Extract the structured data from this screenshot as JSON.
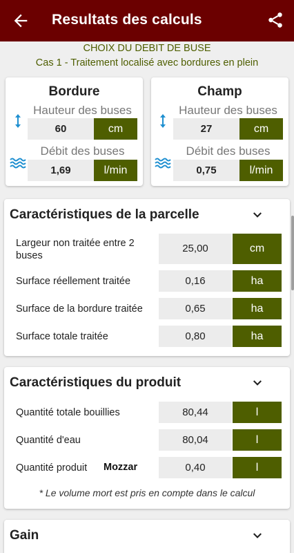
{
  "app": {
    "title": "Resultats des calculs"
  },
  "header": {
    "line1": "CHOIX DU DEBIT DE BUSE",
    "line2": "Cas 1 - Traitement localisé avec bordures en plein"
  },
  "bordure": {
    "title": "Bordure",
    "height_label": "Hauteur des buses",
    "height_value": "60",
    "height_unit": "cm",
    "flow_label": "Débit des buses",
    "flow_value": "1,69",
    "flow_unit": "l/min"
  },
  "champ": {
    "title": "Champ",
    "height_label": "Hauteur des buses",
    "height_value": "27",
    "height_unit": "cm",
    "flow_label": "Débit des buses",
    "flow_value": "0,75",
    "flow_unit": "l/min"
  },
  "parcelle": {
    "title": "Caractéristiques de la parcelle",
    "rows": [
      {
        "label": "Largeur non traitée entre 2 buses",
        "value": "25,00",
        "unit": "cm"
      },
      {
        "label": "Surface réellement traitée",
        "value": "0,16",
        "unit": "ha"
      },
      {
        "label": "Surface de la bordure traitée",
        "value": "0,65",
        "unit": "ha"
      },
      {
        "label": "Surface totale traitée",
        "value": "0,80",
        "unit": "ha"
      }
    ]
  },
  "produit": {
    "title": "Caractéristiques du produit",
    "rows": [
      {
        "label": "Quantité totale bouillies",
        "value": "80,44",
        "unit": "l"
      },
      {
        "label": "Quantité d'eau",
        "value": "80,04",
        "unit": "l"
      },
      {
        "label": "Quantité produit",
        "product": "Mozzar",
        "value": "0,40",
        "unit": "l"
      }
    ],
    "note": "* Le volume mort est pris en compte dans le calcul"
  },
  "gain": {
    "title": "Gain"
  },
  "colors": {
    "appbar": "#6b0000",
    "accent": "#4e5e00",
    "icon": "#1e8fd0"
  }
}
